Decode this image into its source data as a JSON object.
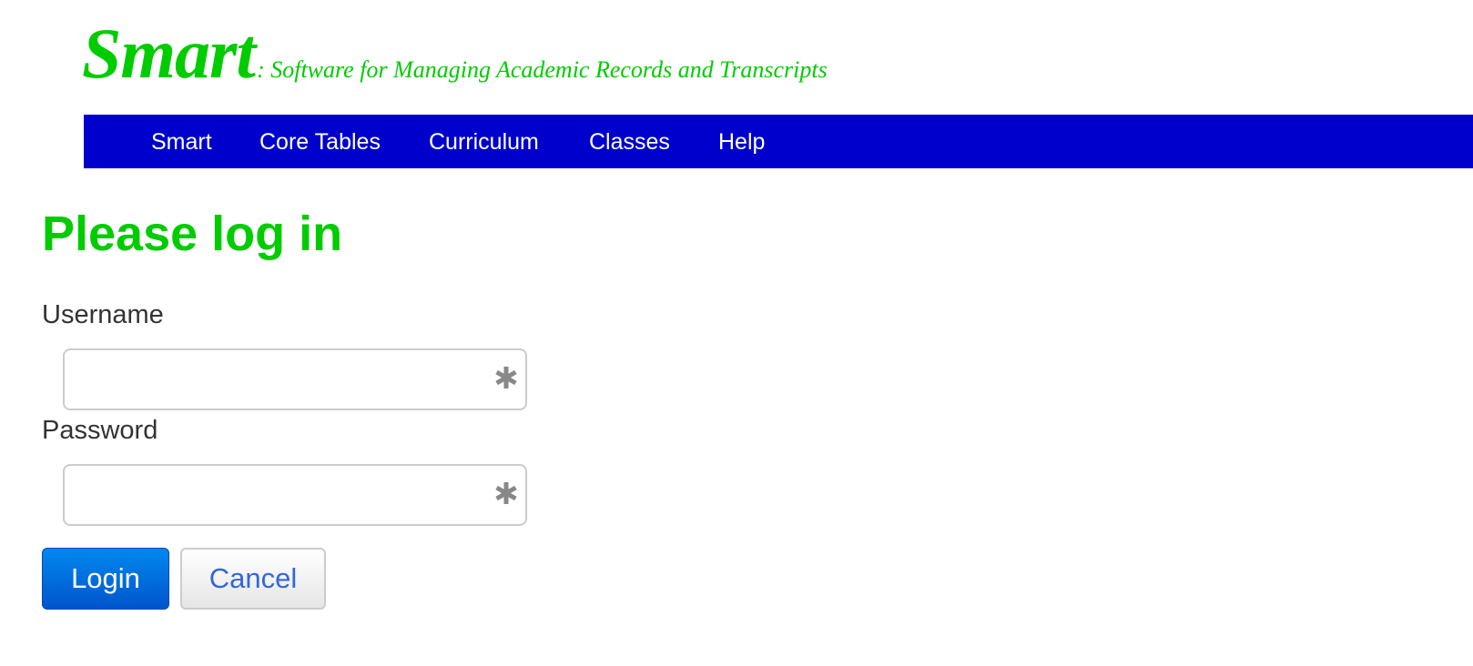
{
  "brand": {
    "name": "Smart",
    "tagline": ": Software for Managing Academic Records and Transcripts",
    "color": "#00cc00"
  },
  "nav": {
    "background": "#0000cc",
    "items": [
      {
        "label": "Smart"
      },
      {
        "label": "Core Tables"
      },
      {
        "label": "Curriculum"
      },
      {
        "label": "Classes"
      },
      {
        "label": "Help"
      }
    ]
  },
  "main": {
    "heading": "Please log in"
  },
  "form": {
    "username": {
      "label": "Username",
      "value": "",
      "icon": "asterisk-icon"
    },
    "password": {
      "label": "Password",
      "value": "",
      "icon": "asterisk-icon"
    },
    "login_label": "Login",
    "cancel_label": "Cancel"
  }
}
